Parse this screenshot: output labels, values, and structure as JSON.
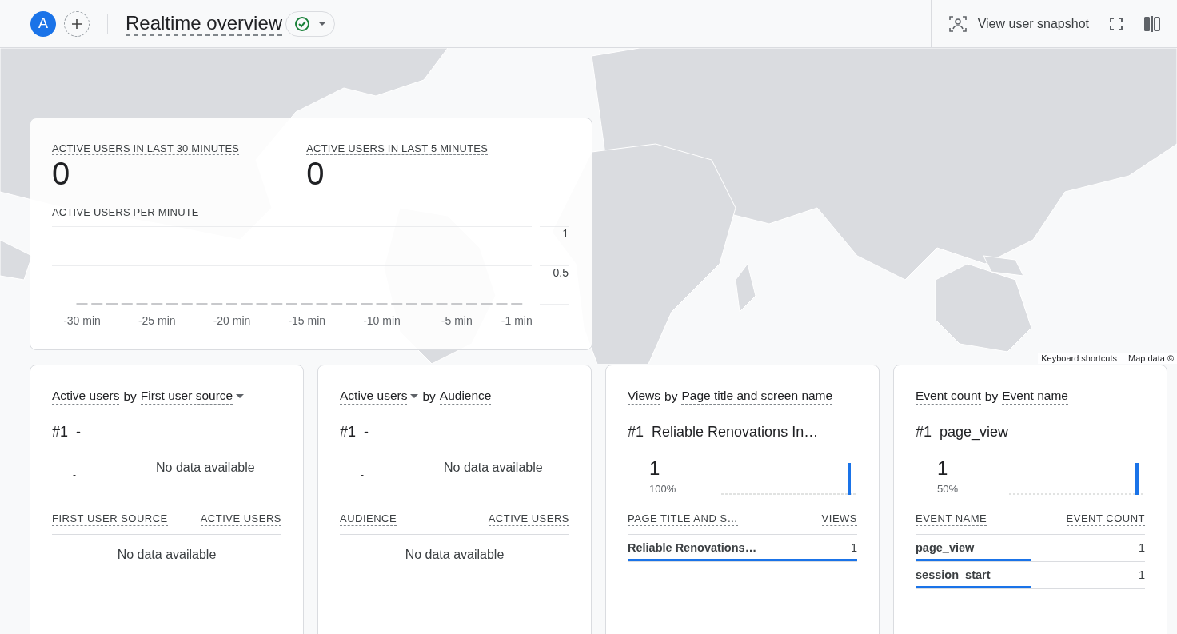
{
  "header": {
    "avatar": "A",
    "title": "Realtime overview",
    "status_ok": true,
    "actions": [
      {
        "kind": "snapshot",
        "label": "View user snapshot"
      },
      {
        "kind": "fullscreen"
      },
      {
        "kind": "compare"
      }
    ]
  },
  "map": {
    "attribution": [
      "Keyboard shortcuts",
      "Map data ©"
    ]
  },
  "overview": {
    "stats": [
      {
        "label": "ACTIVE USERS IN LAST 30 MINUTES",
        "value": "0"
      },
      {
        "label": "ACTIVE USERS IN LAST 5 MINUTES",
        "value": "0"
      }
    ],
    "chart_title": "ACTIVE USERS PER MINUTE",
    "chart_data": {
      "type": "bar",
      "x": [
        -30,
        -29,
        -28,
        -27,
        -26,
        -25,
        -24,
        -23,
        -22,
        -21,
        -20,
        -19,
        -18,
        -17,
        -16,
        -15,
        -14,
        -13,
        -12,
        -11,
        -10,
        -9,
        -8,
        -7,
        -6,
        -5,
        -4,
        -3,
        -2,
        -1
      ],
      "values": [
        0,
        0,
        0,
        0,
        0,
        0,
        0,
        0,
        0,
        0,
        0,
        0,
        0,
        0,
        0,
        0,
        0,
        0,
        0,
        0,
        0,
        0,
        0,
        0,
        0,
        0,
        0,
        0,
        0,
        0
      ],
      "xlim": [
        -32,
        0
      ],
      "ylim": [
        0,
        1
      ],
      "yticks": [
        0.5,
        1
      ],
      "xticks": [
        {
          "value": -30,
          "label": "-30 min"
        },
        {
          "value": -25,
          "label": "-25 min"
        },
        {
          "value": -20,
          "label": "-20 min"
        },
        {
          "value": -15,
          "label": "-15 min"
        },
        {
          "value": -10,
          "label": "-10 min"
        },
        {
          "value": -5,
          "label": "-5 min"
        },
        {
          "value": -1,
          "label": "-1 min"
        }
      ]
    }
  },
  "cards": [
    {
      "kind": "empty",
      "metric": "Active users",
      "metric_dropdown": false,
      "connector": "by",
      "dimension": "First user source",
      "dimension_dropdown": true,
      "rank": "#1",
      "top_name": "-",
      "top_value": "-",
      "message": "No data available",
      "columns": [
        "FIRST USER SOURCE",
        "ACTIVE USERS"
      ],
      "table_message": "No data available"
    },
    {
      "kind": "empty",
      "metric": "Active users",
      "metric_dropdown": true,
      "connector": "by",
      "dimension": "Audience",
      "dimension_dropdown": false,
      "rank": "#1",
      "top_name": "-",
      "top_value": "-",
      "message": "No data available",
      "columns": [
        "AUDIENCE",
        "ACTIVE USERS"
      ],
      "table_message": "No data available"
    },
    {
      "kind": "data",
      "metric": "Views",
      "metric_dropdown": false,
      "connector": "by",
      "dimension": "Page title and screen name",
      "dimension_dropdown": false,
      "rank": "#1",
      "top_name": "Reliable Renovations In…",
      "top_value": "1",
      "share": "100%",
      "columns": [
        "PAGE TITLE AND S…",
        "VIEWS"
      ],
      "rows": [
        {
          "label": "Reliable Renovations…",
          "value": "1",
          "level": 1
        }
      ]
    },
    {
      "kind": "data",
      "metric": "Event count",
      "metric_dropdown": false,
      "connector": "by",
      "dimension": "Event name",
      "dimension_dropdown": false,
      "rank": "#1",
      "top_name": "page_view",
      "top_value": "1",
      "share": "50%",
      "columns": [
        "EVENT NAME",
        "EVENT COUNT"
      ],
      "rows": [
        {
          "label": "page_view",
          "value": "1",
          "level": 0.5
        },
        {
          "label": "session_start",
          "value": "1",
          "level": 0.5
        }
      ]
    }
  ]
}
